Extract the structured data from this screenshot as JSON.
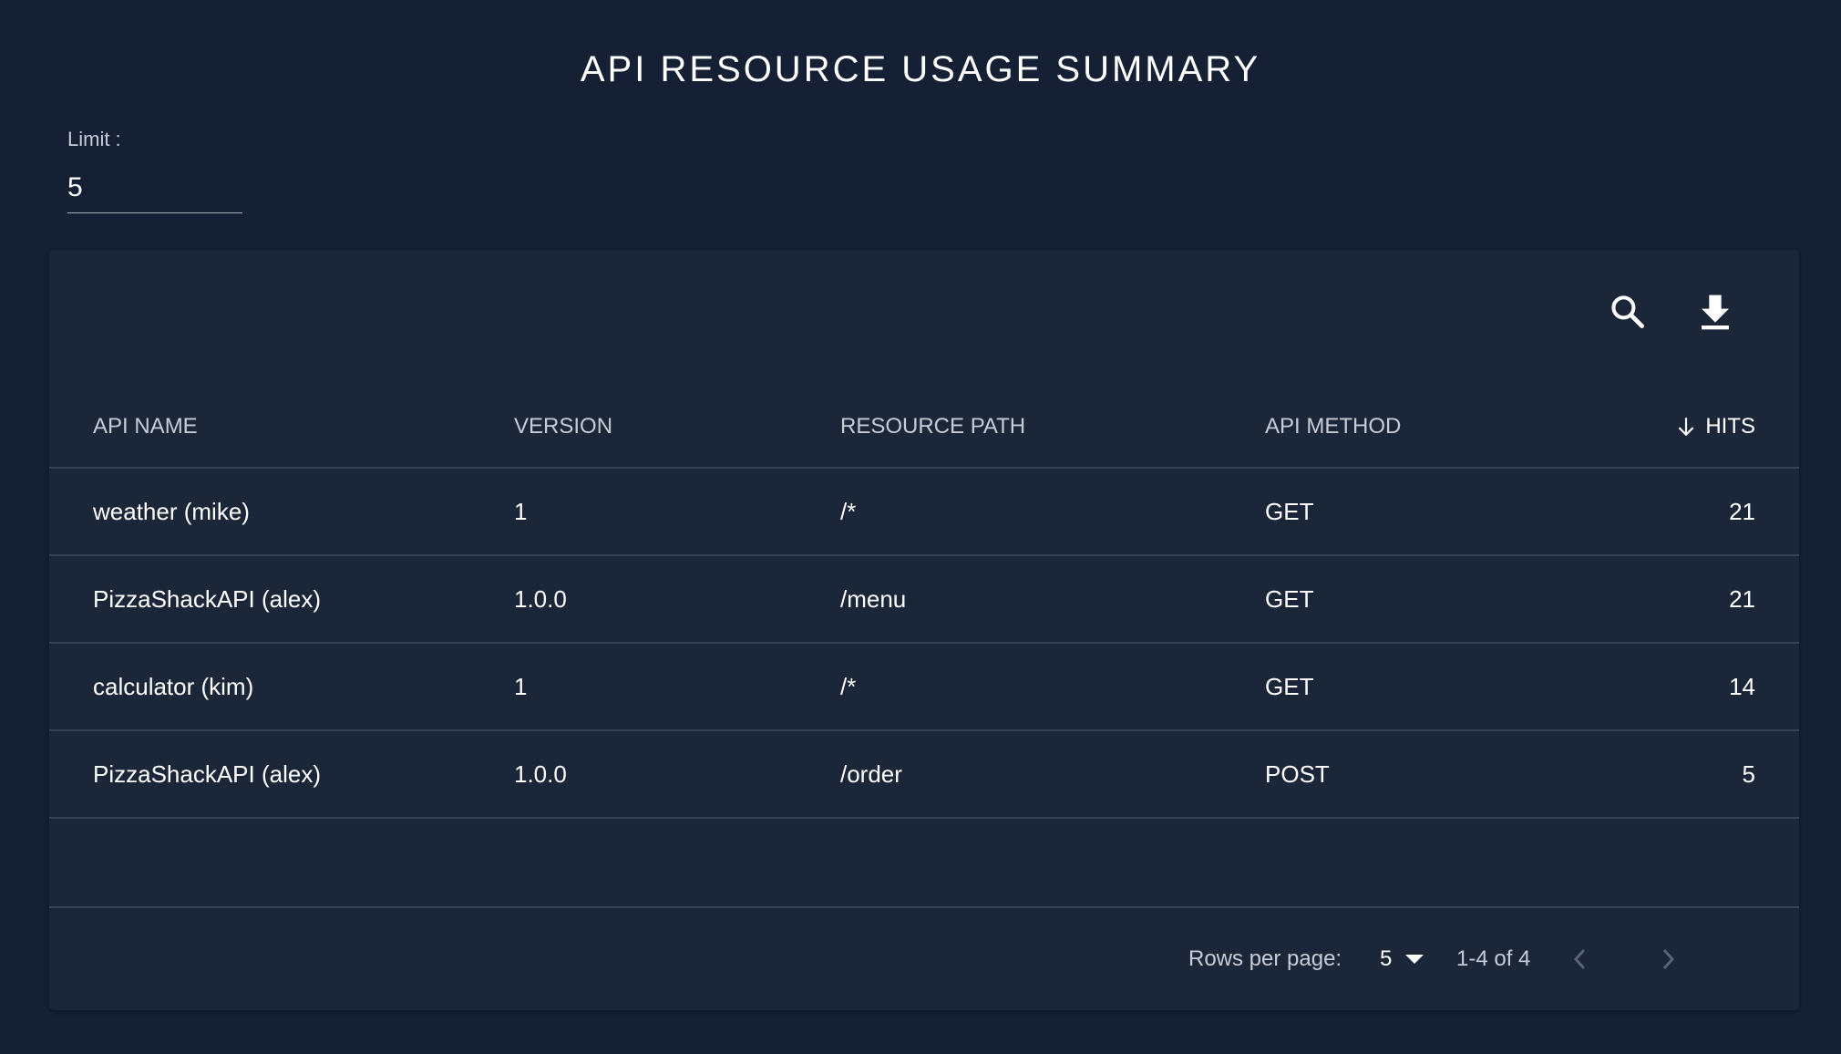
{
  "page": {
    "title": "API RESOURCE USAGE SUMMARY"
  },
  "limit": {
    "label": "Limit :",
    "value": "5"
  },
  "toolbar": {
    "search_icon": "search-icon",
    "download_icon": "download-icon"
  },
  "table": {
    "columns": {
      "api_name": "API NAME",
      "version": "VERSION",
      "resource_path": "RESOURCE PATH",
      "api_method": "API METHOD",
      "hits": "HITS"
    },
    "sort": {
      "column": "hits",
      "direction": "descending",
      "icon": "arrow-down-icon"
    },
    "rows": [
      {
        "api_name": "weather (mike)",
        "version": "1",
        "resource_path": "/*",
        "api_method": "GET",
        "hits": "21"
      },
      {
        "api_name": "PizzaShackAPI (alex)",
        "version": "1.0.0",
        "resource_path": "/menu",
        "api_method": "GET",
        "hits": "21"
      },
      {
        "api_name": "calculator (kim)",
        "version": "1",
        "resource_path": "/*",
        "api_method": "GET",
        "hits": "14"
      },
      {
        "api_name": "PizzaShackAPI (alex)",
        "version": "1.0.0",
        "resource_path": "/order",
        "api_method": "POST",
        "hits": "5"
      }
    ]
  },
  "pagination": {
    "rows_per_page_label": "Rows per page:",
    "rows_per_page_value": "5",
    "range": "1-4 of 4",
    "prev_icon": "chevron-left-icon",
    "next_icon": "chevron-right-icon"
  },
  "colors": {
    "page_background": "#152035",
    "card_background": "#1c2639",
    "divider": "#3a4354",
    "text_primary": "#ffffff",
    "text_secondary": "#c7ccd6",
    "icon_disabled": "#5b6475"
  }
}
